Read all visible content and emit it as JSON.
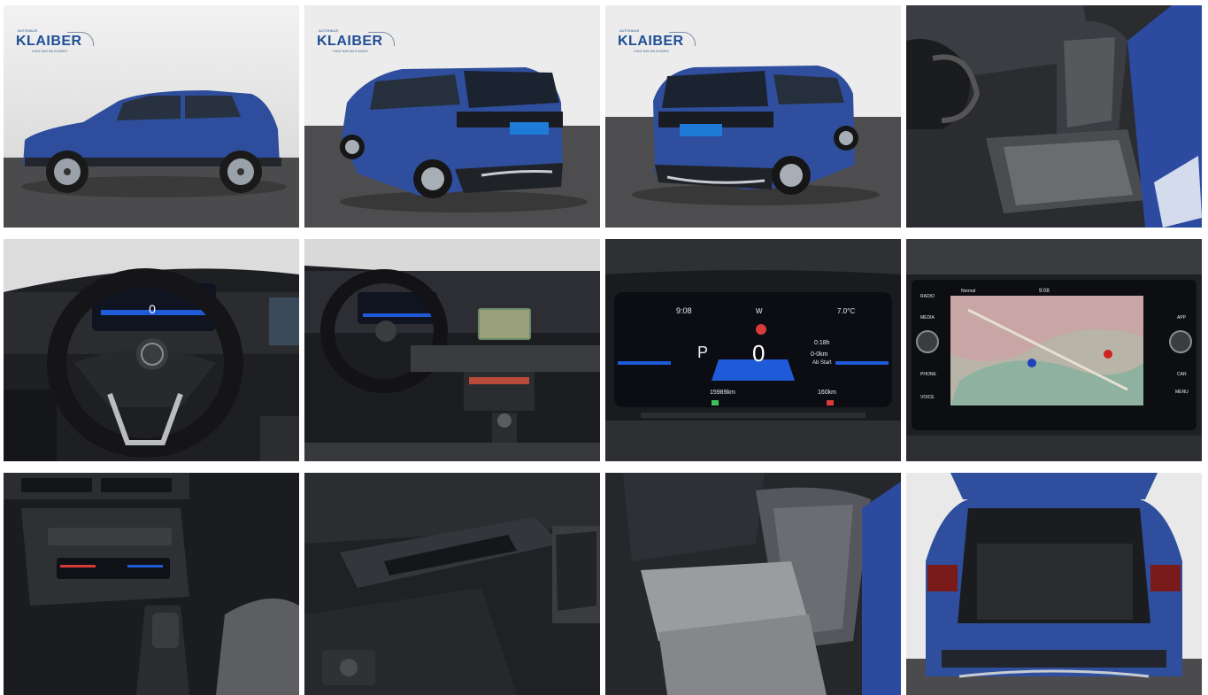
{
  "gallery": {
    "logo": {
      "brand": "KLAIBER",
      "small_line": "AUTOHAUS",
      "tagline": "GANZ NAH AM KUNDEN"
    },
    "photos": [
      {
        "id": "exterior-side",
        "subject": "side view of blue compact SUV"
      },
      {
        "id": "exterior-rear-left",
        "subject": "rear three-quarter view"
      },
      {
        "id": "exterior-rear-right",
        "subject": "rear three-quarter view, other side"
      },
      {
        "id": "front-seats",
        "subject": "driver seat interior"
      },
      {
        "id": "steering-wheel",
        "subject": "steering wheel and digital cockpit"
      },
      {
        "id": "dashboard",
        "subject": "dashboard overview"
      },
      {
        "id": "instrument-cluster",
        "subject": "digital instrument cluster"
      },
      {
        "id": "navigation-screen",
        "subject": "infotainment navigation display"
      },
      {
        "id": "climate-console",
        "subject": "climate controls and gear selector"
      },
      {
        "id": "door-panel",
        "subject": "door panel and window switches"
      },
      {
        "id": "rear-seats",
        "subject": "rear bench seat"
      },
      {
        "id": "trunk",
        "subject": "open trunk"
      }
    ],
    "cluster": {
      "time": "9:08",
      "gear": "P",
      "speed": "0",
      "odometer": "15989km",
      "range": "160km",
      "trip": "0:18h",
      "avg": "0-0km",
      "ab_start": "Ab Start",
      "temp": "7.0°C",
      "w_label": "W"
    },
    "nav": {
      "radio": "RADIO",
      "media": "MEDIA",
      "phone": "PHONE",
      "voice": "VOICE",
      "app": "APP",
      "car": "CAR",
      "menu": "MENU",
      "normal": "Normal",
      "time": "9:08"
    },
    "colors": {
      "car_blue": "#2f4f9e",
      "studio_wall": "#e9e9e9",
      "studio_floor": "#4a4a4a",
      "interior_dark": "#1d1e20",
      "cluster_blue": "#1f5bd8"
    }
  }
}
